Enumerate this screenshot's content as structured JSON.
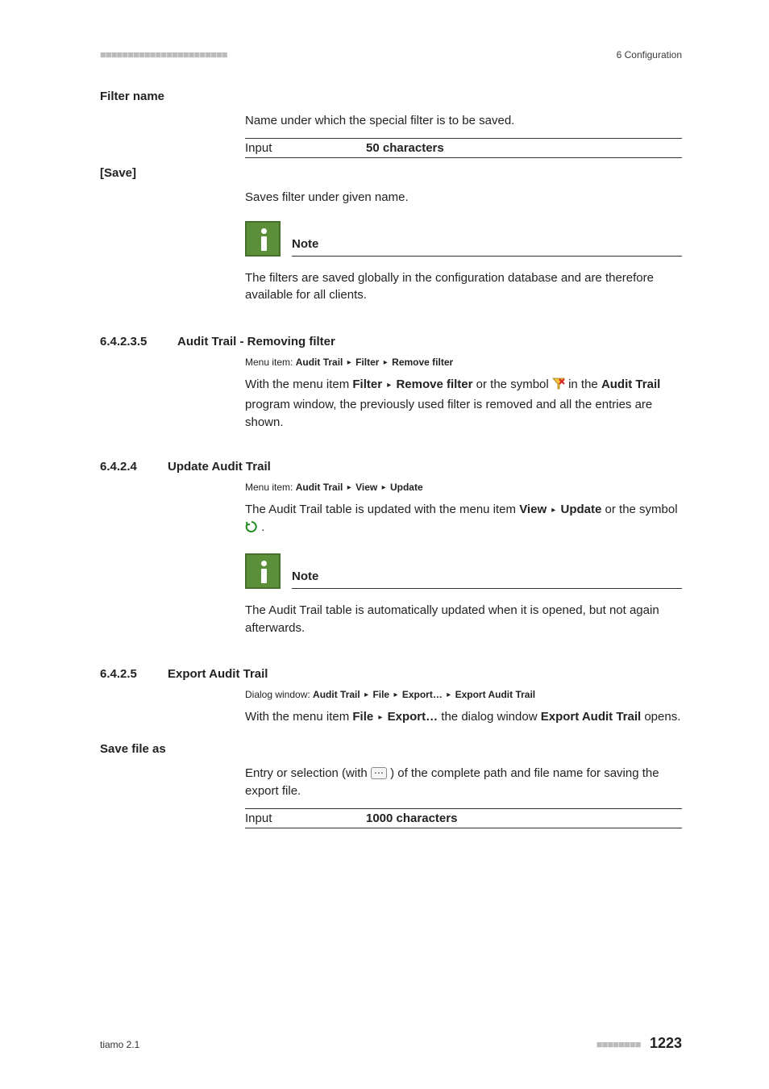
{
  "header": {
    "left_marks": "■■■■■■■■■■■■■■■■■■■■■■■",
    "right": "6 Configuration"
  },
  "s1": {
    "heading": "Filter name",
    "desc": "Name under which the special filter is to be saved.",
    "input_label": "Input",
    "input_value": "50 characters"
  },
  "s2": {
    "heading": "[Save]",
    "desc": "Saves filter under given name.",
    "note_title": "Note",
    "note_body": "The filters are saved globally in the configuration database and are therefore available for all clients."
  },
  "s3": {
    "num": "6.4.2.3.5",
    "title": "Audit Trail - Removing filter",
    "menu_prefix": "Menu item: ",
    "menu_a": "Audit Trail",
    "menu_b": "Filter",
    "menu_c": "Remove filter",
    "body_1a": "With the menu item ",
    "body_1b": "Filter",
    "body_1c": "Remove filter",
    "body_1d": " or the symbol ",
    "body_1e": " in the ",
    "body_1f": "Audit Trail",
    "body_1g": " program window, the previously used filter is removed and all the entries are shown."
  },
  "s4": {
    "num": "6.4.2.4",
    "title": "Update Audit Trail",
    "menu_prefix": "Menu item: ",
    "menu_a": "Audit Trail",
    "menu_b": "View",
    "menu_c": "Update",
    "body_1a": "The Audit Trail table is updated with the menu item ",
    "body_1b": "View",
    "body_1c": "Update",
    "body_1d": " or the symbol ",
    "body_1e": ".",
    "note_title": "Note",
    "note_body": "The Audit Trail table is automatically updated when it is opened, but not again afterwards."
  },
  "s5": {
    "num": "6.4.2.5",
    "title": "Export Audit Trail",
    "dlg_prefix": "Dialog window: ",
    "dlg_a": "Audit Trail",
    "dlg_b": "File",
    "dlg_c": "Export…",
    "dlg_d": "Export Audit Trail",
    "body_1a": "With the menu item ",
    "body_1b": "File",
    "body_1c": "Export…",
    "body_1d": " the dialog window ",
    "body_1e": "Export Audit Trail",
    "body_1f": " opens."
  },
  "s6": {
    "heading": "Save file as",
    "body_a": "Entry or selection (with ",
    "body_b": ") of the complete path and file name for saving the export file.",
    "input_label": "Input",
    "input_value": "1000 characters",
    "ellipsis": "⋯"
  },
  "footer": {
    "left": "tiamo 2.1",
    "ticks": "■■■■■■■■",
    "page": "1223"
  },
  "tri": "▸"
}
